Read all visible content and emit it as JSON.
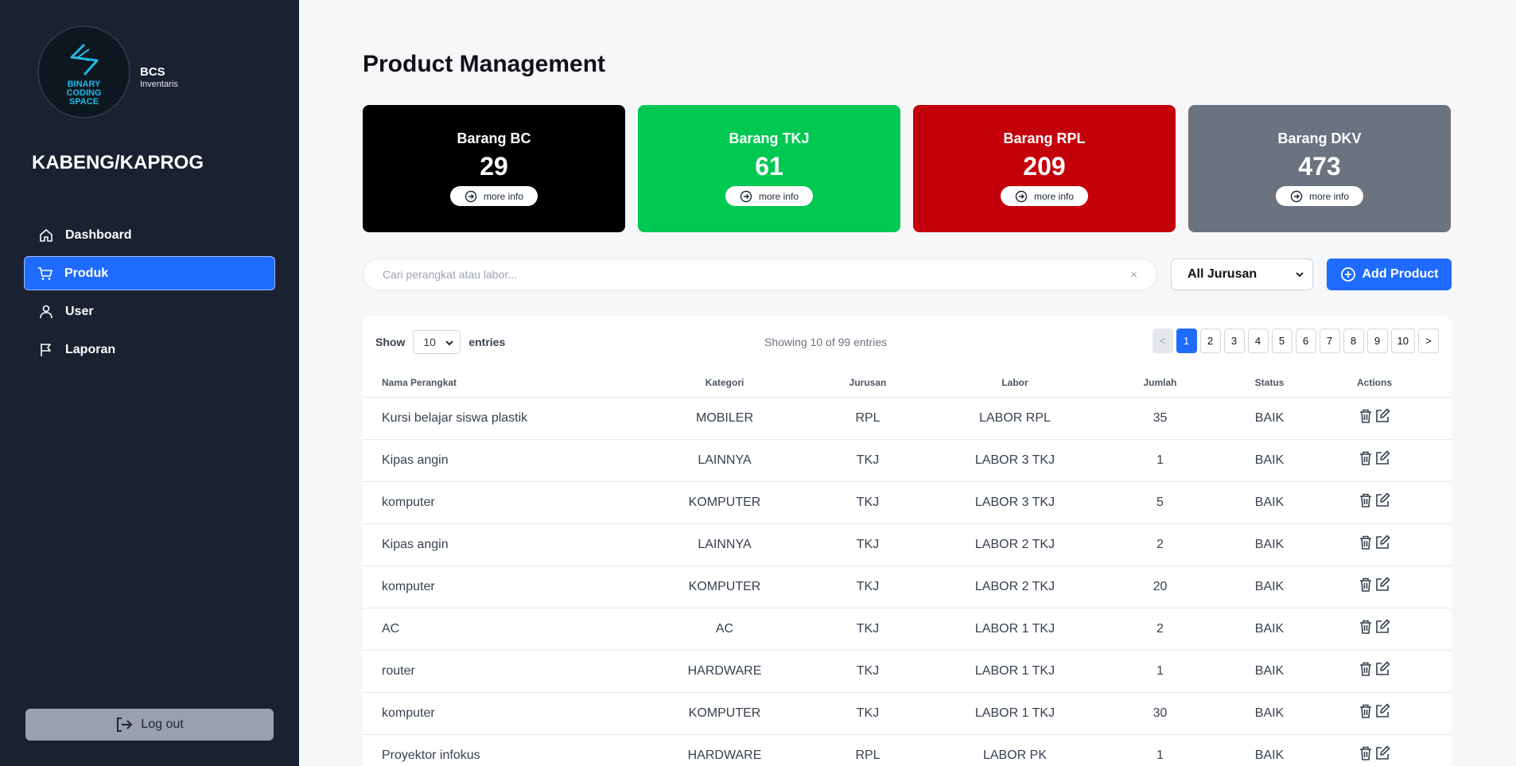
{
  "sidebar": {
    "logo_text": [
      "BINARY",
      "CODING",
      "SPACE"
    ],
    "brand_title": "BCS",
    "brand_subtitle": "Inventaris",
    "role": "KABENG/KAPROG",
    "nav": [
      {
        "label": "Dashboard",
        "icon": "home-icon",
        "active": false
      },
      {
        "label": "Produk",
        "icon": "cart-icon",
        "active": true
      },
      {
        "label": "User",
        "icon": "user-icon",
        "active": false
      },
      {
        "label": "Laporan",
        "icon": "flag-icon",
        "active": false
      }
    ],
    "logout_label": "Log out"
  },
  "header": {
    "title": "Product Management"
  },
  "cards": [
    {
      "title": "Barang BC",
      "value": "29",
      "more": "more info",
      "color": "#000000"
    },
    {
      "title": "Barang TKJ",
      "value": "61",
      "more": "more info",
      "color": "#00c853"
    },
    {
      "title": "Barang RPL",
      "value": "209",
      "more": "more info",
      "color": "#c4000b"
    },
    {
      "title": "Barang DKV",
      "value": "473",
      "more": "more info",
      "color": "#6b7280"
    }
  ],
  "search": {
    "placeholder": "Cari perangkat atau labor...",
    "clear": "×"
  },
  "filter": {
    "selected": "All Jurusan"
  },
  "add_button": "Add Product",
  "table_controls": {
    "show_label": "Show",
    "entries_value": "10",
    "entries_label": "entries",
    "showing": "Showing 10 of 99 entries",
    "pages": [
      "<",
      "1",
      "2",
      "3",
      "4",
      "5",
      "6",
      "7",
      "8",
      "9",
      "10",
      ">"
    ]
  },
  "table": {
    "headers": [
      "Nama Perangkat",
      "Kategori",
      "Jurusan",
      "Labor",
      "Jumlah",
      "Status",
      "Actions"
    ],
    "rows": [
      [
        "Kursi belajar siswa plastik",
        "MOBILER",
        "RPL",
        "LABOR RPL",
        "35",
        "BAIK"
      ],
      [
        "Kipas angin",
        "LAINNYA",
        "TKJ",
        "LABOR 3 TKJ",
        "1",
        "BAIK"
      ],
      [
        "komputer",
        "KOMPUTER",
        "TKJ",
        "LABOR 3 TKJ",
        "5",
        "BAIK"
      ],
      [
        "Kipas angin",
        "LAINNYA",
        "TKJ",
        "LABOR 2 TKJ",
        "2",
        "BAIK"
      ],
      [
        "komputer",
        "KOMPUTER",
        "TKJ",
        "LABOR 2 TKJ",
        "20",
        "BAIK"
      ],
      [
        "AC",
        "AC",
        "TKJ",
        "LABOR 1 TKJ",
        "2",
        "BAIK"
      ],
      [
        "router",
        "HARDWARE",
        "TKJ",
        "LABOR 1 TKJ",
        "1",
        "BAIK"
      ],
      [
        "komputer",
        "KOMPUTER",
        "TKJ",
        "LABOR 1 TKJ",
        "30",
        "BAIK"
      ],
      [
        "Proyektor infokus",
        "HARDWARE",
        "RPL",
        "LABOR PK",
        "1",
        "BAIK"
      ]
    ]
  },
  "colors": {
    "sidebar": "#1a2130",
    "accent": "#1f6bff",
    "logout": "#9aa1ad"
  }
}
